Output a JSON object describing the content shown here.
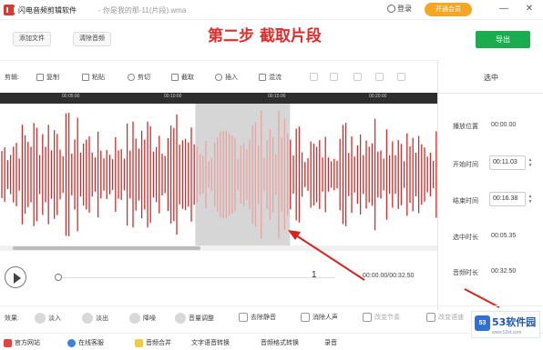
{
  "titlebar": {
    "app_title": "闪电音频剪辑软件",
    "file_title": "- 你是我的那-11(片段).wma",
    "login_label": "登录",
    "vip_label": "开通会员",
    "minimize": "—",
    "close": "✕"
  },
  "toolbar": {
    "add_file": "添加文件",
    "clear_audio": "清除音频",
    "step_label": "第二步 截取片段",
    "export": "导出"
  },
  "edit": {
    "label": "剪辑:",
    "items": [
      "复制",
      "粘贴",
      "剪切",
      "截取",
      "插入",
      "混流"
    ]
  },
  "ruler": {
    "ticks": [
      "00:05:00",
      "00:10:00",
      "00:15:00",
      "00:20:00"
    ]
  },
  "sidebar": {
    "title": "选中",
    "play_pos_label": "播放位置",
    "play_pos_value": "00:00.00",
    "start_label": "开始时间",
    "start_value": "00:11.03",
    "end_label": "结束时间",
    "end_value": "00:16.38",
    "duration_label": "选中时长",
    "duration_value": "00:05.35",
    "audio_len_label": "音频时长",
    "audio_len_value": "00:32.50"
  },
  "player": {
    "page": "1",
    "time": "00:00.00/00:32.50"
  },
  "effects": {
    "label": "效果:",
    "items": [
      "淡入",
      "淡出",
      "降噪",
      "音量调整",
      "去除静音",
      "消除人声",
      "改变节奏",
      "改变语速"
    ]
  },
  "footer": {
    "items": [
      "官方网站",
      "在线客服",
      "音频合并",
      "文字语音转换",
      "音频格式转换",
      "录音"
    ]
  },
  "watermark": {
    "badge": "53",
    "name": "53软件园",
    "url": "www.53xt.com"
  },
  "colors": {
    "wave": "#d42a2a",
    "selection": "#d6d6d6",
    "export": "#1aac4f",
    "vip": "#f5a623",
    "annotation": "#e02c2c"
  },
  "selection": {
    "start": 11.03,
    "end": 16.38,
    "total": 32.5
  }
}
